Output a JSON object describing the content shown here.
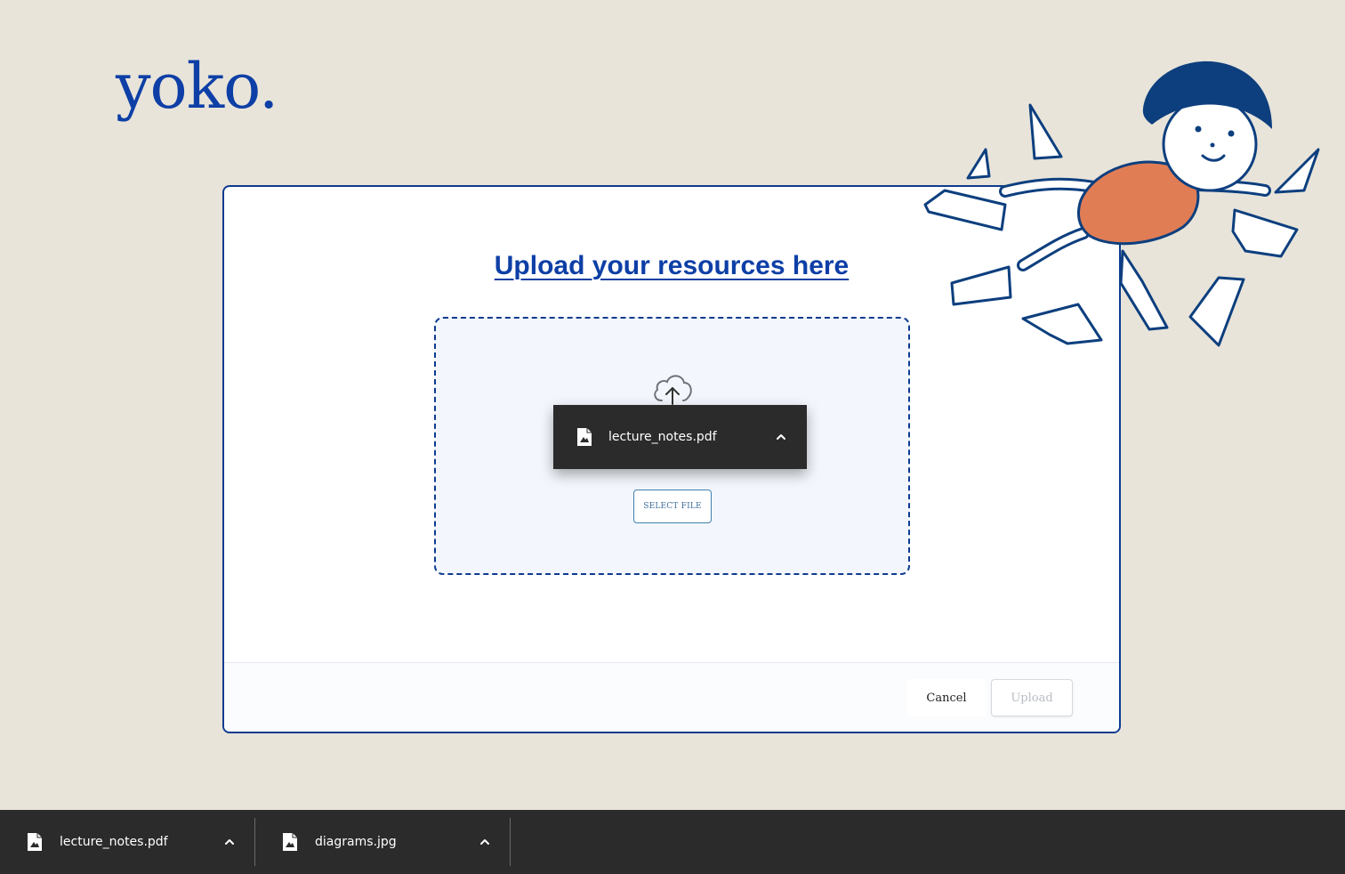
{
  "brand": {
    "logo_text": "yoko."
  },
  "upload_card": {
    "title": "Upload your resources here",
    "select_file_label": "SELECT FILE",
    "cancel_label": "Cancel",
    "upload_label": "Upload"
  },
  "toast": {
    "file_name": "lecture_notes.pdf"
  },
  "downloads": [
    {
      "file_name": "lecture_notes.pdf"
    },
    {
      "file_name": "diagrams.jpg"
    }
  ],
  "colors": {
    "background": "#e8e4da",
    "brand_blue": "#0d3fa6",
    "card_border": "#0d3b8f",
    "dark_bar": "#2b2b2b",
    "illustration_orange": "#e07d55"
  },
  "icons": {
    "upload": "cloud-upload-icon",
    "file": "image-file-icon",
    "expand": "chevron-up-icon"
  }
}
